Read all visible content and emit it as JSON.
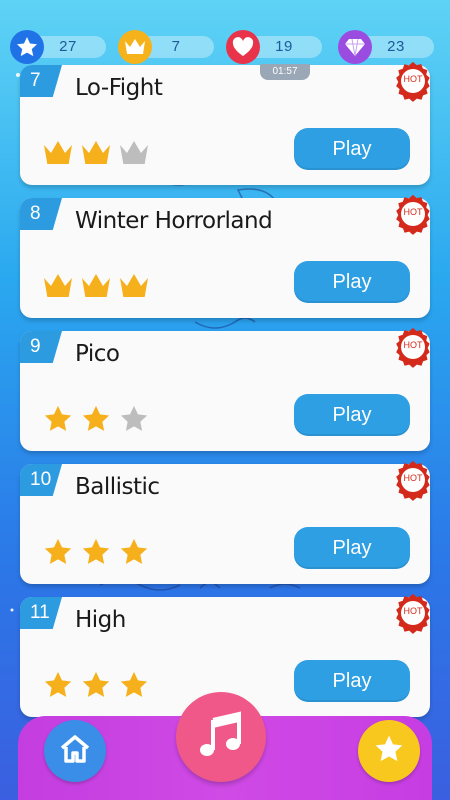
{
  "stats": [
    {
      "name": "stars",
      "value": "27",
      "color": "#1f73e6",
      "icon": "star-icon"
    },
    {
      "name": "crowns",
      "value": "7",
      "color": "#f5b21b",
      "icon": "crown-icon"
    },
    {
      "name": "lives",
      "value": "19",
      "color": "#e8334a",
      "icon": "heart-icon"
    },
    {
      "name": "gems",
      "value": "23",
      "color": "#9b4ce0",
      "icon": "diamond-icon"
    }
  ],
  "timer": "01:57",
  "songs": [
    {
      "number": "7",
      "title": "Lo-Fight",
      "rating_type": "crown",
      "rating": 2,
      "max": 3,
      "play_label": "Play",
      "hot_label": "HOT"
    },
    {
      "number": "8",
      "title": "Winter Horrorland",
      "rating_type": "crown",
      "rating": 3,
      "max": 3,
      "play_label": "Play",
      "hot_label": "HOT"
    },
    {
      "number": "9",
      "title": "Pico",
      "rating_type": "star",
      "rating": 2,
      "max": 3,
      "play_label": "Play",
      "hot_label": "HOT"
    },
    {
      "number": "10",
      "title": "Ballistic",
      "rating_type": "star",
      "rating": 3,
      "max": 3,
      "play_label": "Play",
      "hot_label": "HOT"
    },
    {
      "number": "11",
      "title": "High",
      "rating_type": "star",
      "rating": 3,
      "max": 3,
      "play_label": "Play",
      "hot_label": "HOT"
    }
  ],
  "nav": {
    "home_icon": "home-icon",
    "music_icon": "music-note-icon",
    "favorites_icon": "star-icon"
  },
  "colors": {
    "gold": "#f6b01c",
    "gray": "#bdbdbd",
    "play": "#2e9fe3",
    "number_tab": "#2d9be0",
    "hot_badge": "#d42a1b",
    "nav_bar": "#c83fe2",
    "home_button": "#3a8ee8",
    "music_button": "#f0588a",
    "favorites_button": "#f8c81e"
  }
}
